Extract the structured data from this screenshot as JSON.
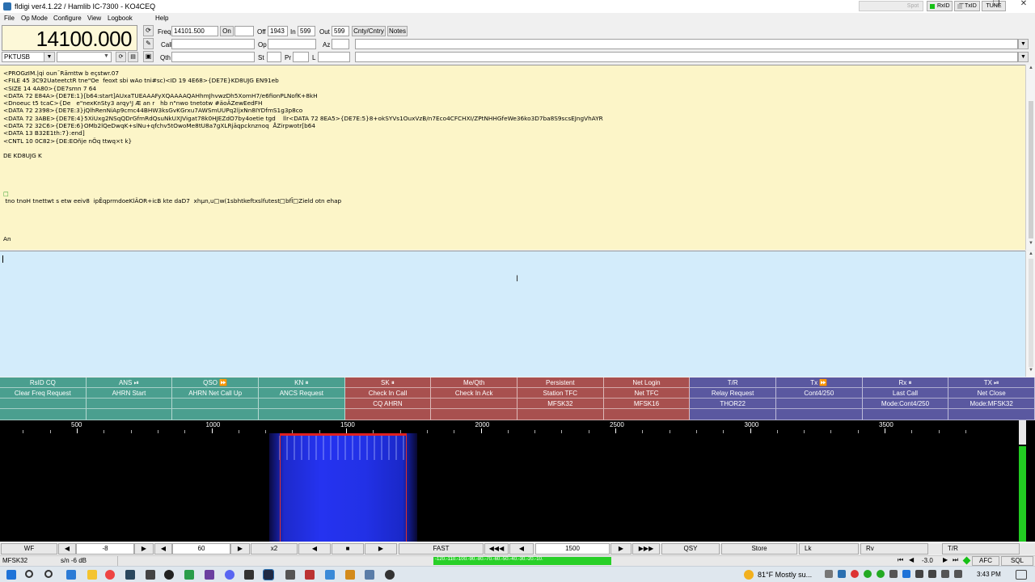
{
  "window": {
    "title": "fldigi ver4.1.22 / Hamlib IC-7300 - KO4CEQ",
    "spot_label": "Spot",
    "rxid_label": "RxID",
    "txid_label": "TxID",
    "tune_label": "TUNE"
  },
  "menu": [
    "File",
    "Op Mode",
    "Configure",
    "View",
    "Logbook",
    "Help"
  ],
  "rig": {
    "frequency_display": "14100.000",
    "mode": "PKTUSB"
  },
  "log": {
    "freq_label": "Freq",
    "freq_value": "14101.500",
    "on_label": "On",
    "on_value": "",
    "off_label": "Off",
    "off_value": "1943",
    "in_label": "In",
    "in_value": "599",
    "out_label": "Out",
    "out_value": "599",
    "cnty_label": "Cnty/Cntry",
    "notes_label": "Notes",
    "call_label": "Call",
    "call_value": "",
    "op_label": "Op",
    "op_value": "",
    "az_label": "Az",
    "az_value": "",
    "qth_label": "Qth",
    "qth_value": "",
    "st_label": "St",
    "st_value": "",
    "pr_label": "Pr",
    "pr_value": "",
    "l_label": "L",
    "l_value": ""
  },
  "rx_text": {
    "lines": [
      "<PROGzIM.|qi oun¯Rāmttw b eçstwr.07",
      "<FILE 45 3C92UateetctR tne\"Oe  feoxt sbi wAo tni#sc)<ID 19 4E68>{DE7E}KD8UJG EN91eb",
      "<SIZE 14 4A80>{DE7smn 7 64",
      "<DATA 72 E84A>{DE7E:1}[b64:start]AUxaTUEAAAFyXQAAAAQAHhmJhvwzDh5XomH7/e6fionPLNofK+8kH",
      "<Dnoeuc t5 tcaC>{De   e\"nexKnSty3 arqy¹J Æ an r   hb n\"nwo tnetotw #äoÄZewEedFH",
      "<DATA 72 2398>{DE7E:3}jQlhRenNiAp9cmc44BHW3ksGvKGrxu7AWSmUUPq2ljxNn8IYDfmS1g3p8co",
      "<DATA 72 3ABE>{DE7E:4}5XiUxg2NSqQDrGfmRdQsuNkUXJVigat78k0HJEZdO7by4oetie tgd    llr<DATA 72 8EA5>{DE7E:5}8+okSYVs1OuxVzB/n7Eco4CFCHXI/ZPtNHHGfeWe36ko3D7ba8S9scsEJngVhAYR",
      "<DATA 72 32C6>{DE7E:6}OMb2lQeDwqK+slNu+qfchv5tOwoMe8tU8a7gXLRjāqpcknznoq  ÅZirpwotr[b64",
      "<DATA 13 B32E1th:7}:end]",
      "<CNTL 10 0C82>{DE:EOñje nÖq ttwq×t k}",
      "",
      "DE KD8UJG K",
      "",
      "",
      "",
      "",
      "□",
      " tno tnoH tnettwt s etw eeiv8  ipÊqprmdoeKlÄOR+icB kte daD7  xhµn,u□w(1sbhtkeftxslfutest□bfĪ□Zield otn ehap",
      "",
      "",
      "",
      "",
      "An"
    ]
  },
  "macros": [
    {
      "label": "RsID CQ",
      "color": "#4a9f8f"
    },
    {
      "label": "ANS ⏯",
      "color": "#4a9f8f"
    },
    {
      "label": "QSO ⏩",
      "color": "#4a9f8f"
    },
    {
      "label": "KN ⏸",
      "color": "#4a9f8f"
    },
    {
      "label": "SK ⏸",
      "color": "#a8504f"
    },
    {
      "label": "Me/Qth",
      "color": "#a8504f"
    },
    {
      "label": "Persistent",
      "color": "#a8504f"
    },
    {
      "label": "Net Login",
      "color": "#a8504f"
    },
    {
      "label": "T/R",
      "color": "#5a58a0"
    },
    {
      "label": "Tx ⏩",
      "color": "#5a58a0"
    },
    {
      "label": "Rx ⏸",
      "color": "#5a58a0"
    },
    {
      "label": "TX ⏯",
      "color": "#5a58a0"
    },
    {
      "label": "Clear Freq Request",
      "color": "#4a9f8f"
    },
    {
      "label": "AHRN Start",
      "color": "#4a9f8f"
    },
    {
      "label": "AHRN Net Call Up",
      "color": "#4a9f8f"
    },
    {
      "label": "ANCS Request",
      "color": "#4a9f8f"
    },
    {
      "label": "Check In Call",
      "color": "#a8504f"
    },
    {
      "label": "Check In Ack",
      "color": "#a8504f"
    },
    {
      "label": "Station TFC",
      "color": "#a8504f"
    },
    {
      "label": "Net TFC",
      "color": "#a8504f"
    },
    {
      "label": "Relay Request",
      "color": "#5a58a0"
    },
    {
      "label": "Cont4/250",
      "color": "#5a58a0"
    },
    {
      "label": "Last Call",
      "color": "#5a58a0"
    },
    {
      "label": "Net Close",
      "color": "#5a58a0"
    },
    {
      "label": "",
      "color": "#4a9f8f"
    },
    {
      "label": "",
      "color": "#4a9f8f"
    },
    {
      "label": "",
      "color": "#4a9f8f"
    },
    {
      "label": "",
      "color": "#4a9f8f"
    },
    {
      "label": "CQ AHRN",
      "color": "#a8504f"
    },
    {
      "label": "",
      "color": "#a8504f"
    },
    {
      "label": "MFSK32",
      "color": "#a8504f"
    },
    {
      "label": "MFSK16",
      "color": "#a8504f"
    },
    {
      "label": "THOR22",
      "color": "#5a58a0"
    },
    {
      "label": "",
      "color": "#5a58a0"
    },
    {
      "label": "Mode:Cont4/250",
      "color": "#5a58a0"
    },
    {
      "label": "Mode:MFSK32",
      "color": "#5a58a0"
    },
    {
      "label": "",
      "color": "#4a9f8f"
    },
    {
      "label": "",
      "color": "#4a9f8f"
    },
    {
      "label": "",
      "color": "#4a9f8f"
    },
    {
      "label": "",
      "color": "#4a9f8f"
    },
    {
      "label": "",
      "color": "#a8504f"
    },
    {
      "label": "",
      "color": "#a8504f"
    },
    {
      "label": "",
      "color": "#a8504f"
    },
    {
      "label": "",
      "color": "#a8504f"
    },
    {
      "label": "",
      "color": "#5a58a0"
    },
    {
      "label": "",
      "color": "#5a58a0"
    },
    {
      "label": "",
      "color": "#5a58a0"
    },
    {
      "label": "",
      "color": "#5a58a0"
    }
  ],
  "waterfall": {
    "scale_ticks": [
      "500",
      "1000",
      "1500",
      "2000",
      "2500",
      "3000",
      "3500"
    ],
    "signal_color": "#1a2aff",
    "cursor_color": "#ff2020"
  },
  "controls": {
    "wf_label": "WF",
    "ref_value": "-8",
    "range_value": "60",
    "zoom_label": "x2",
    "speed_label": "FAST",
    "carrier_value": "1500",
    "qsy_label": "QSY",
    "store_label": "Store",
    "lk_label": "Lk",
    "rv_label": "Rv",
    "tr_label": "T/R"
  },
  "status": {
    "mode": "MFSK32",
    "sn": "s/n  -6 dB",
    "imd": "",
    "scale_text": "-120.-110.-100.-90.-80.-70.-60.-50.-40.-30.-20.-10.",
    "afc_offset": "-3.0",
    "afc_label": "AFC",
    "sql_label": "SQL"
  },
  "taskbar": {
    "weather": "81°F  Mostly su...",
    "time": "3:43 PM"
  }
}
